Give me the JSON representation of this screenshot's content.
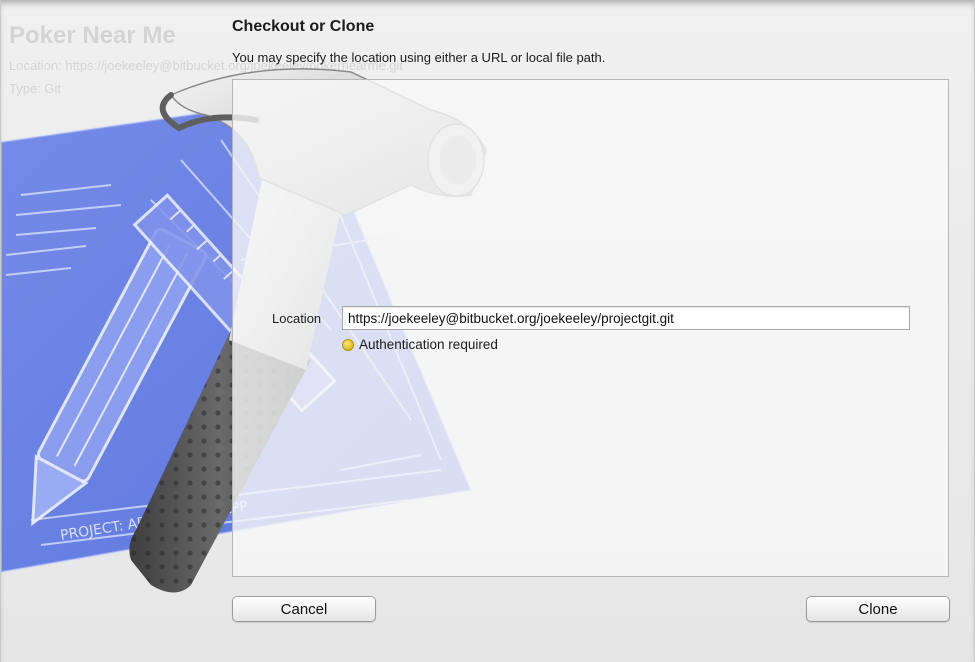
{
  "background_window": {
    "title": "Poker Near Me",
    "location_line": "Location: https://joekeeley@bitbucket.org/joekeeley/pokernearme.git",
    "type_line": "Type: Git"
  },
  "artwork": {
    "blueprint_caption": "PROJECT: APPLICATION.APP",
    "icon": "xcode-hammer-blueprint-icon"
  },
  "dialog": {
    "title": "Checkout or Clone",
    "subtitle": "You may specify the location using either a URL or local file path.",
    "location_label": "Location",
    "location_value": "https://joekeeley@bitbucket.org/joekeeley/projectgit.git",
    "status_text": "Authentication required",
    "status_color": "#e0bd1a",
    "cancel_label": "Cancel",
    "clone_label": "Clone"
  }
}
